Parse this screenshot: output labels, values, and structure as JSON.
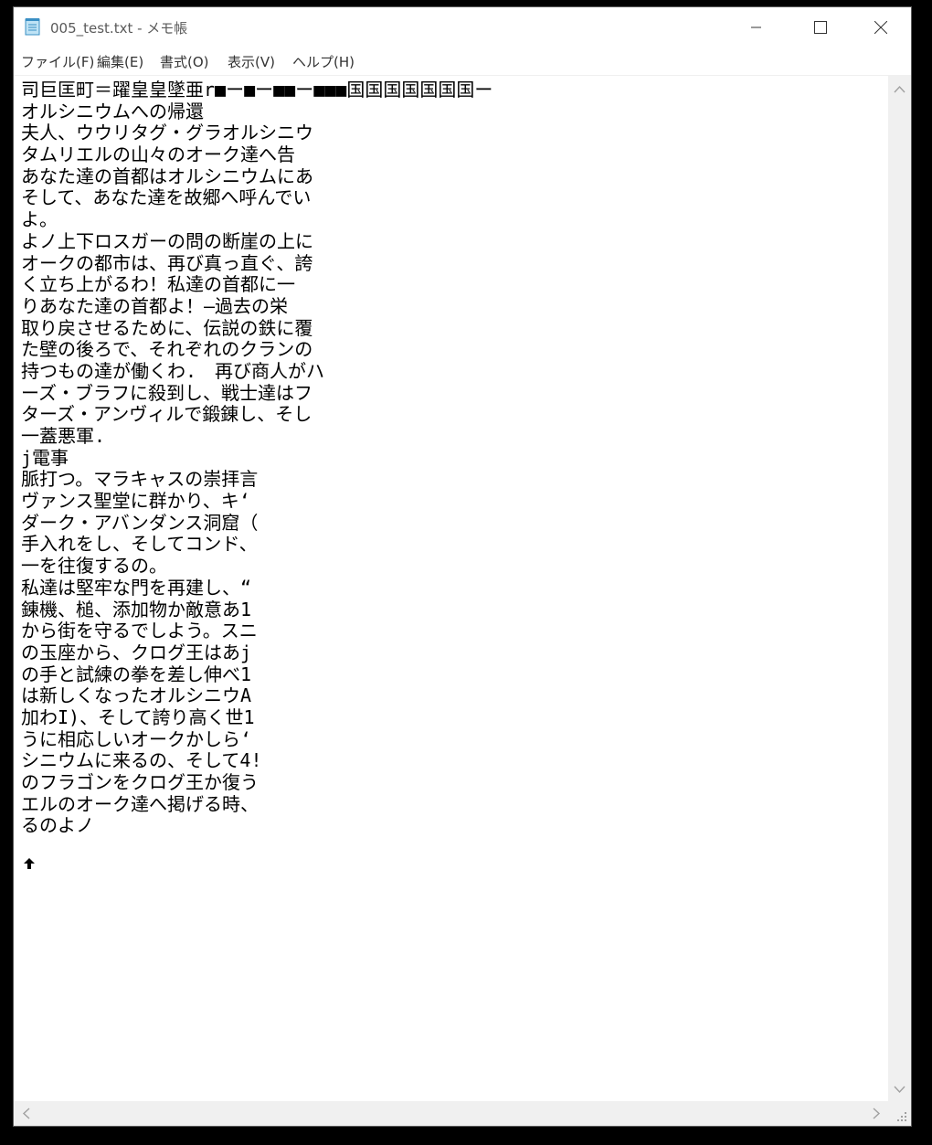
{
  "window": {
    "title": "005_test.txt - メモ帳",
    "controls": {
      "minimize_icon": "minimize-icon",
      "maximize_icon": "maximize-icon",
      "close_icon": "close-icon"
    }
  },
  "menu": {
    "items": [
      {
        "label": "ファイル(F)"
      },
      {
        "label": "編集(E)"
      },
      {
        "label": "書式(O)"
      },
      {
        "label": "表示(V)"
      },
      {
        "label": "ヘルプ(H)"
      }
    ]
  },
  "document": {
    "lines": [
      "司巨匡町＝躍皇皇墜亜r■ー■ー■■ー■■■国国国国国国国ー",
      "オルシニウムへの帰還",
      "夫人、ウウリタグ・グラオルシニウ",
      "タムリエルの山々のオーク達へ告",
      "あなた達の首都はオルシニウムにあ",
      "そして、あなた達を故郷へ呼んでい",
      "よ。",
      "よノ上下ロスガーの問の断崖の上に",
      "オークの都市は、再び真っ直ぐ、誇",
      "く立ち上がるわ！私達の首都に一",
      "りあなた達の首都よ！—過去の栄",
      "取り戻させるために、伝説の鉄に覆",
      "た壁の後ろで、それぞれのクランの",
      "持つもの達が働くわ.　再び商人がハ",
      "ーズ・ブラフに殺到し、戦士達はフ",
      "ターズ・アンヴィルで鍛錬し、そし",
      "一蓋悪軍.",
      "j電事",
      "脈打つ。マラキャスの崇拝言",
      "ヴァンス聖堂に群かり、キ‘",
      "ダーク・アバンダンス洞窟（",
      "手入れをし、そしてコンド、",
      "一を往復するの。",
      "私達は堅牢な門を再建し、“",
      "錬機、槌、添加物か敵意あ1",
      "から街を守るでしよう。スニ",
      "の玉座から、クログ王はあj",
      "の手と試練の拳を差し伸べ1",
      "は新しくなったオルシニウA",
      "加わI)、そして誇り高く世1",
      "うに相応しいオークかしら‘",
      "シニウムに来るの、そして4!",
      "のフラゴンをクログ王か復う",
      "エルのオーク達へ掲げる時、",
      "るのよノ"
    ],
    "trailing_glyph_icon": "up-arrow-glyph-icon"
  },
  "scrollbars": {
    "up_icon": "scroll-up-icon",
    "down_icon": "scroll-down-icon",
    "left_icon": "scroll-left-icon",
    "right_icon": "scroll-right-icon",
    "grip_icon": "size-grip-icon"
  }
}
